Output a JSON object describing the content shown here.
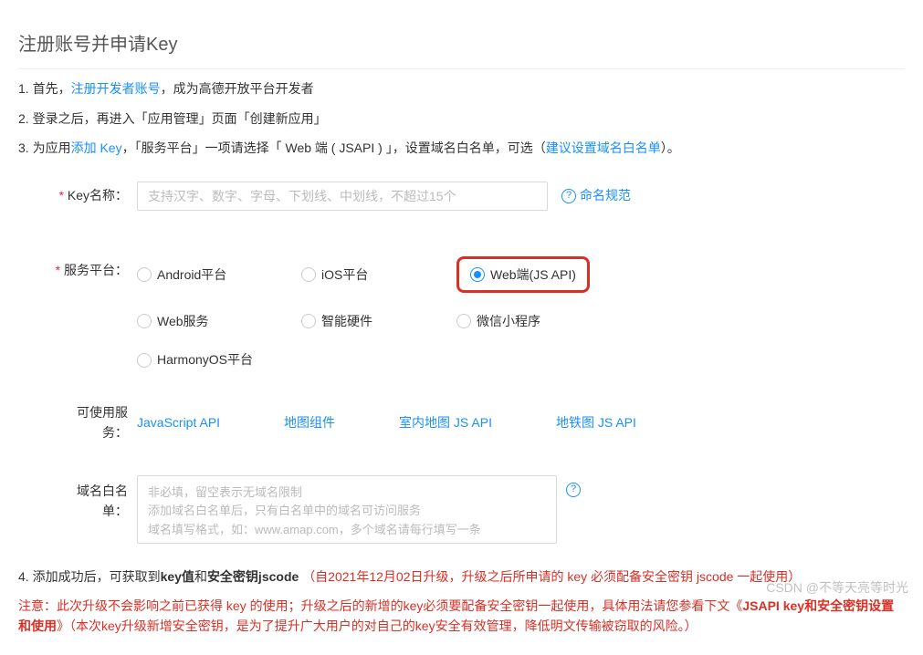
{
  "title": "注册账号并申请Key",
  "steps": {
    "s1": {
      "prefix": "首先，",
      "link": "注册开发者账号",
      "suffix": "，成为高德开放平台开发者"
    },
    "s2": "登录之后，再进入「应用管理」页面「创建新应用」",
    "s3": {
      "a": "为应用",
      "link1": "添加 Key",
      "b": "，「服务平台」一项请选择「 Web 端 ( JSAPI ) 」，设置域名白名单，可选（",
      "link2": "建议设置域名白名单",
      "c": "）。"
    }
  },
  "form": {
    "keyName": {
      "label": "Key名称：",
      "placeholder": "支持汉字、数字、字母、下划线、中划线，不超过15个",
      "help": "命名规范"
    },
    "platform": {
      "label": "服务平台：",
      "options": [
        "Android平台",
        "iOS平台",
        "Web端(JS API)",
        "Web服务",
        "智能硬件",
        "微信小程序",
        "HarmonyOS平台"
      ]
    },
    "services": {
      "label": "可使用服务：",
      "links": [
        "JavaScript API",
        "地图组件",
        "室内地图 JS API",
        "地铁图 JS API"
      ]
    },
    "whitelist": {
      "label": "域名白名单：",
      "line1": "非必填，留空表示无域名限制",
      "line2": "添加域名白名单后，只有白名单中的域名可访问服务",
      "line3": "域名填写格式，如：www.amap.com，多个域名请每行填写一条"
    }
  },
  "step4": {
    "a": "添加成功后，可获取到",
    "bold1": "key值",
    "b": "和",
    "bold2": "安全密钥jscode",
    "red": "（自2021年12月02日升级，升级之后所申请的 key 必须配备安全密钥 jscode 一起使用）"
  },
  "note": {
    "a": "注意：此次升级不会影响之前已获得 key 的使用；升级之后的新增的key必须要配备安全密钥一起使用，具体用法请您参看下文《",
    "link": "JSAPI key和安全密钥设置和使用",
    "b": "》（本次key升级新增安全密钥，是为了提升广大用户的对自己的key安全有效管理，降低明文传输被窃取的风险。）"
  },
  "watermark": "CSDN @不等天亮等时光"
}
